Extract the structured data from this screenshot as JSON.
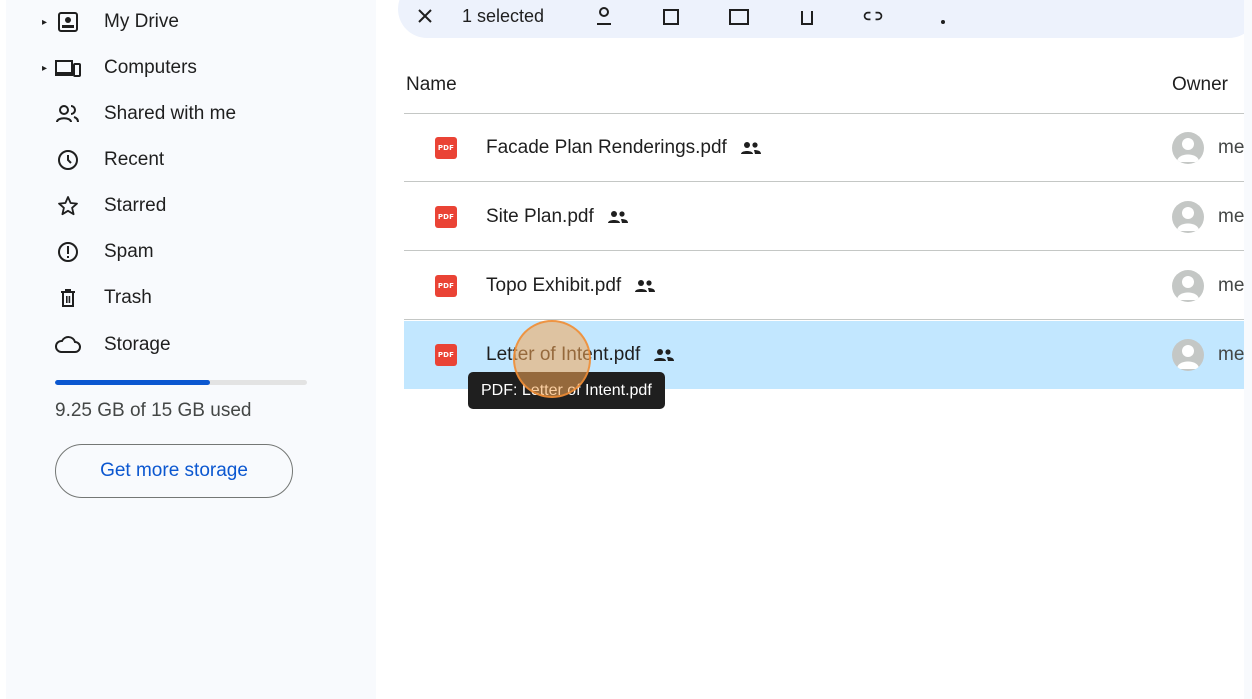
{
  "sidebar": {
    "nav": [
      {
        "label": "My Drive",
        "icon": "my-drive-icon",
        "expandable": true
      },
      {
        "label": "Computers",
        "icon": "computers-icon",
        "expandable": true
      },
      {
        "label": "Shared with me",
        "icon": "shared-with-me-icon",
        "expandable": false
      },
      {
        "label": "Recent",
        "icon": "recent-clock-icon",
        "expandable": false
      },
      {
        "label": "Starred",
        "icon": "star-icon",
        "expandable": false
      },
      {
        "label": "Spam",
        "icon": "spam-icon",
        "expandable": false
      },
      {
        "label": "Trash",
        "icon": "trash-icon",
        "expandable": false
      },
      {
        "label": "Storage",
        "icon": "cloud-icon",
        "expandable": false
      }
    ],
    "storage": {
      "used_text": "9.25 GB of 15 GB used",
      "used_fraction": 0.617,
      "button_label": "Get more storage"
    }
  },
  "action_bar": {
    "selected_text": "1 selected",
    "icons": [
      "close-icon",
      "share-icon",
      "download-icon",
      "move-icon",
      "delete-icon",
      "link-icon",
      "more-icon"
    ]
  },
  "file_list": {
    "header_name": "Name",
    "header_owner": "Owner",
    "files": [
      {
        "name": "Facade Plan Renderings.pdf",
        "type_label": "PDF",
        "owner": "me",
        "shared": true,
        "selected": false
      },
      {
        "name": "Site Plan.pdf",
        "type_label": "PDF",
        "owner": "me",
        "shared": true,
        "selected": false
      },
      {
        "name": "Topo Exhibit.pdf",
        "type_label": "PDF",
        "owner": "me",
        "shared": true,
        "selected": false
      },
      {
        "name": "Letter of Intent.pdf",
        "type_label": "PDF",
        "owner": "me",
        "shared": true,
        "selected": true
      }
    ]
  },
  "tooltip": {
    "text": "PDF: Letter of Intent.pdf"
  },
  "colors": {
    "accent": "#0b57d0",
    "selected_row": "#c2e7ff",
    "pdf_red": "#ea4335",
    "sidebar_bg": "#f8fafd"
  }
}
